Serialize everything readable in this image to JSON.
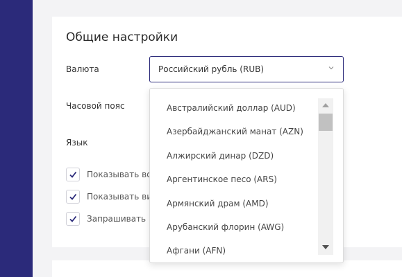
{
  "settings": {
    "title": "Общие настройки",
    "currency_label": "Валюта",
    "currency_value": "Российский рубль (RUB)",
    "timezone_label": "Часовой пояс",
    "language_label": "Язык",
    "checkboxes": [
      {
        "label": "Показывать возраст",
        "checked": true
      },
      {
        "label": "Показывать вид",
        "checked": true
      },
      {
        "label": "Запрашивать ре",
        "checked": true
      }
    ]
  },
  "dropdown": {
    "options": [
      "Австралийский доллар (AUD)",
      "Азербайджанский манат (AZN)",
      "Алжирский динар (DZD)",
      "Аргентинское песо (ARS)",
      "Армянский драм (AMD)",
      "Арубанский флорин (AWG)",
      "Афгани (AFN)"
    ]
  },
  "colors": {
    "sidebar": "#2b2a7a",
    "accent": "#2b2a7a",
    "background": "#f3f3f5"
  },
  "icons": {
    "select_chevron": "chevron-down-icon",
    "check": "check-icon",
    "scroll_up": "arrow-up-icon",
    "scroll_down": "arrow-down-icon"
  }
}
